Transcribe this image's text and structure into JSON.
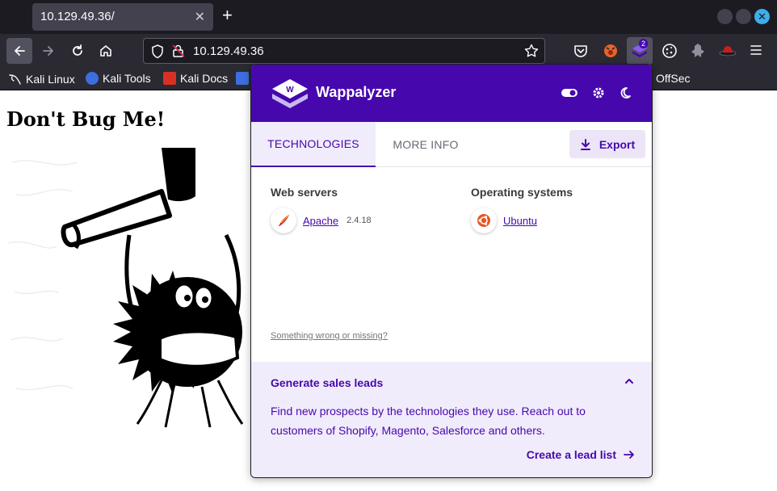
{
  "browser": {
    "tab_title": "10.129.49.36/",
    "tab_close": "✕",
    "new_tab": "+",
    "url": "10.129.49.36",
    "window_close": "✕"
  },
  "bookmarks": [
    {
      "label": "Kali Linux",
      "icon": "kali-dragon-icon",
      "color": "#ffffff"
    },
    {
      "label": "Kali Tools",
      "icon": "kali-tools-icon",
      "color": "#3d6ee0"
    },
    {
      "label": "Kali Docs",
      "icon": "kali-docs-icon",
      "color": "#d93025"
    },
    {
      "label": "OffSec",
      "icon": "offsec-icon",
      "color": "#ffffff"
    }
  ],
  "page": {
    "heading": "Don't Bug Me!"
  },
  "wappalyzer": {
    "title": "Wappalyzer",
    "tabs": {
      "technologies": "TECHNOLOGIES",
      "more_info": "MORE INFO"
    },
    "export_label": "Export",
    "categories": [
      {
        "name": "Web servers",
        "tech": "Apache",
        "version": "2.4.18",
        "icon": "apache-feather-icon"
      },
      {
        "name": "Operating systems",
        "tech": "Ubuntu",
        "version": "",
        "icon": "ubuntu-icon"
      }
    ],
    "wrong_link": "Something wrong or missing?",
    "leads": {
      "title": "Generate sales leads",
      "description": "Find new prospects by the technologies they use. Reach out to customers of Shopify, Magento, Salesforce and others.",
      "link": "Create a lead list"
    },
    "colors": {
      "brand": "#4608ad",
      "light": "#f1ecfb"
    }
  },
  "extensions": {
    "wappalyzer_badge": "2"
  }
}
